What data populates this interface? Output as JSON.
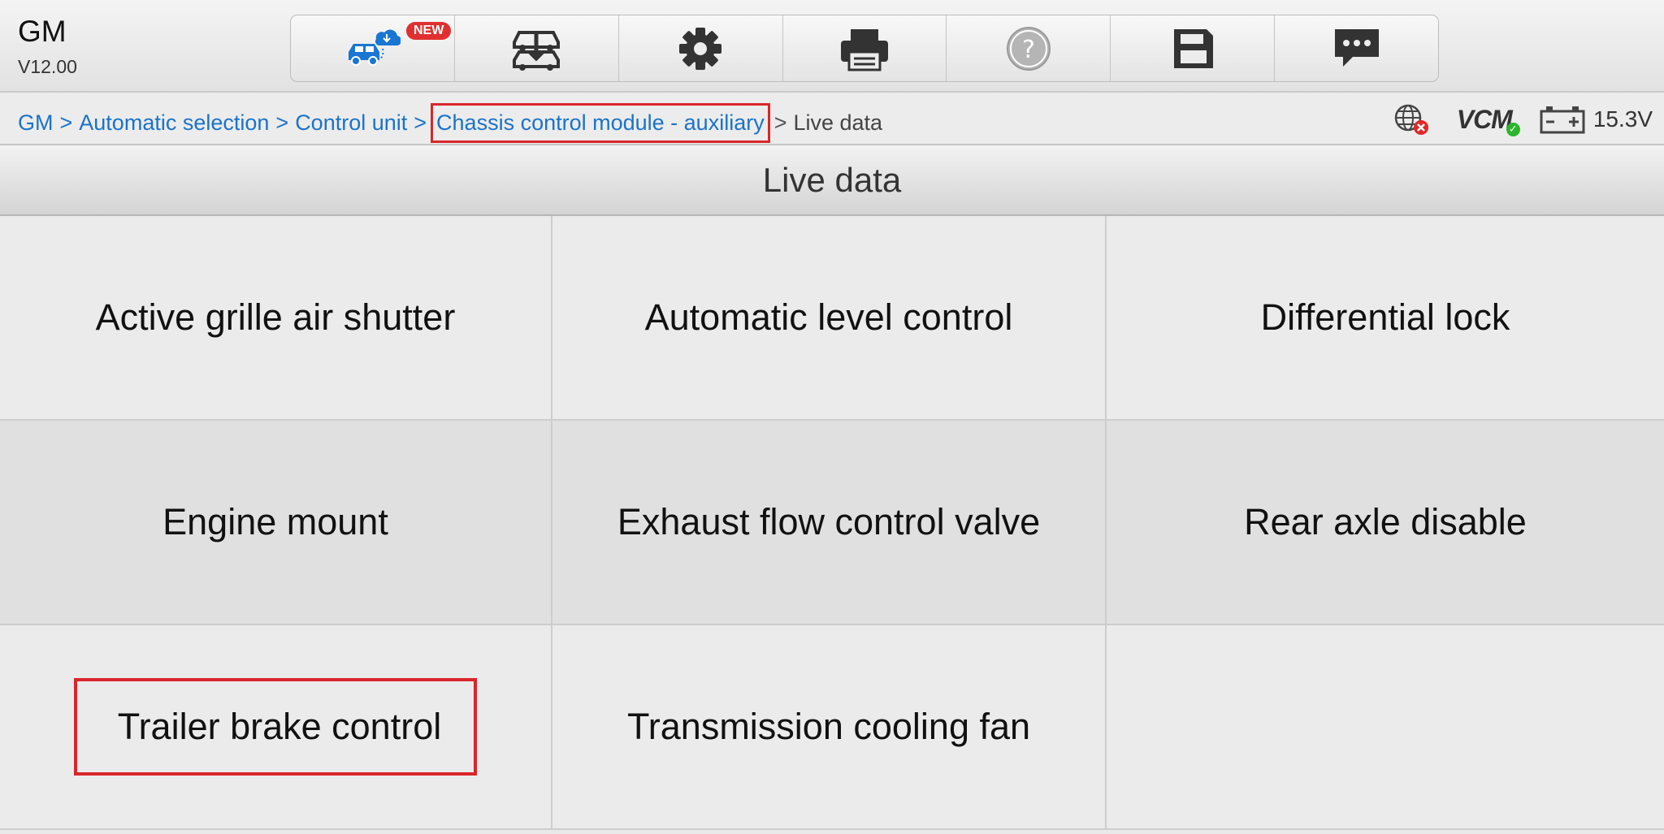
{
  "app": {
    "brand": "GM",
    "version": "V12.00"
  },
  "toolbar": {
    "new_badge": "NEW",
    "items": [
      "remote-diagnostics-icon",
      "vehicle-swap-icon",
      "gear-icon",
      "printer-icon",
      "help-icon",
      "save-icon",
      "chat-icon"
    ]
  },
  "breadcrumb": {
    "items": [
      "GM",
      "Automatic selection",
      "Control unit",
      "Chassis control module - auxiliary"
    ],
    "separator": ">",
    "current": "Live data"
  },
  "status": {
    "network": {
      "icon": "globe-icon",
      "state": "disconnected"
    },
    "vcm": {
      "label": "VCM",
      "state": "connected"
    },
    "battery": {
      "icon": "battery-icon",
      "voltage": "15.3V"
    }
  },
  "page": {
    "title": "Live data"
  },
  "grid": {
    "items": [
      "Active grille air shutter",
      "Automatic level control",
      "Differential lock",
      "Engine mount",
      "Exhaust flow control valve",
      "Rear axle disable",
      "Trailer brake control",
      "Transmission cooling fan",
      ""
    ]
  },
  "colors": {
    "link": "#1a73c9",
    "highlight": "#d9262b",
    "badge": "#e03030",
    "ok": "#2bb52b",
    "error": "#e02828"
  }
}
